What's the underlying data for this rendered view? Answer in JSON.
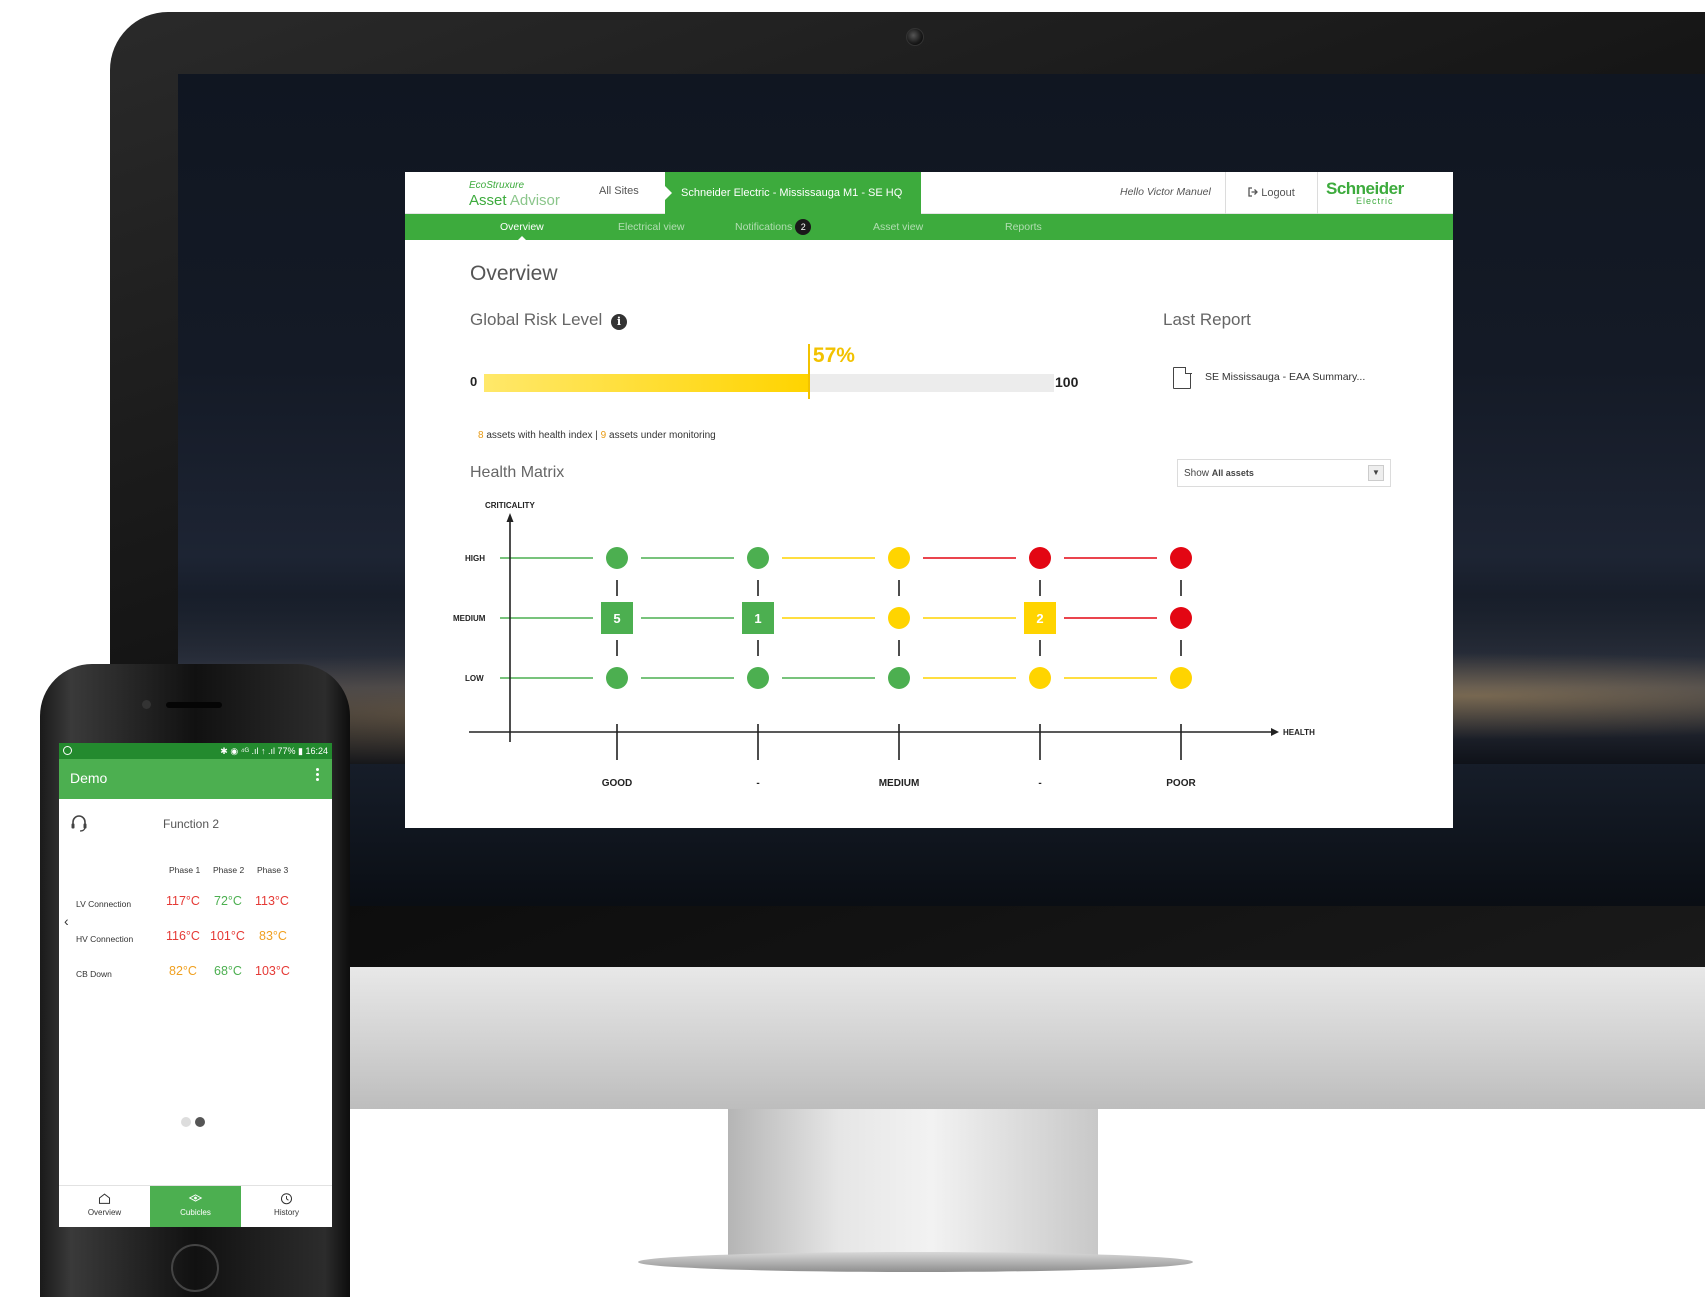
{
  "desktop": {
    "brand": {
      "line1": "EcoStruxure",
      "line2_a": "Asset ",
      "line2_b": "Advisor"
    },
    "header": {
      "all_sites": "All Sites",
      "site": "Schneider Electric - Mississauga M1 - SE HQ",
      "hello": "Hello Victor Manuel",
      "logout_icon": "logout-icon",
      "logout": "Logout",
      "logo_line1": "Schneider",
      "logo_line2": "Electric"
    },
    "nav": {
      "tabs": [
        {
          "label": "Overview",
          "active": true
        },
        {
          "label": "Electrical view",
          "active": false
        },
        {
          "label": "Notifications",
          "badge": "2",
          "active": false
        },
        {
          "label": "Asset view",
          "active": false
        },
        {
          "label": "Reports",
          "active": false
        }
      ]
    },
    "overview": {
      "title": "Overview",
      "risk_title": "Global Risk Level",
      "info_icon": "i",
      "gauge": {
        "min": "0",
        "max": "100",
        "value": 57,
        "value_label": "57%",
        "color": "#ffd400"
      },
      "assets": {
        "health_count": "8",
        "health_text": " assets with health index | ",
        "monitor_count": "9",
        "monitor_text": " assets under monitoring"
      },
      "last_report": {
        "title": "Last Report",
        "icon": "document-icon",
        "item": "SE Mississauga - EAA Summary..."
      },
      "health_matrix": {
        "title": "Health Matrix",
        "show_label": "Show",
        "show_value": "All assets",
        "y_axis": "CRITICALITY",
        "x_axis": "HEALTH",
        "rows": [
          "HIGH",
          "MEDIUM",
          "LOW"
        ],
        "columns": [
          "GOOD",
          "-",
          "MEDIUM",
          "-",
          "POOR"
        ],
        "cells": [
          [
            "green",
            "green",
            "yellow",
            "red",
            "red"
          ],
          [
            "green",
            "green",
            "yellow",
            "yellow",
            "red"
          ],
          [
            "green",
            "green",
            "green",
            "yellow",
            "yellow"
          ]
        ],
        "counts": [
          [
            null,
            null,
            null,
            null,
            null
          ],
          [
            "5",
            "1",
            null,
            "2",
            null
          ],
          [
            null,
            null,
            null,
            null,
            null
          ]
        ],
        "colors": {
          "green": "#4caf50",
          "yellow": "#ffd400",
          "red": "#e30613",
          "axis": "#222222"
        }
      }
    }
  },
  "mobile": {
    "status": "✱ ◉ ⁴ᴳ .ıl ↑ .ıl 77% ▮ 16:24",
    "title": "Demo",
    "function": "Function 2",
    "phases": [
      "Phase 1",
      "Phase 2",
      "Phase 3"
    ],
    "rows": [
      {
        "label": "LV Connection",
        "values": [
          "117°C",
          "72°C",
          "113°C"
        ],
        "colors": [
          "#e53935",
          "#4caf50",
          "#e53935"
        ]
      },
      {
        "label": "HV Connection",
        "values": [
          "116°C",
          "101°C",
          "83°C"
        ],
        "colors": [
          "#e53935",
          "#e53935",
          "#f0a020"
        ]
      },
      {
        "label": "CB Down",
        "values": [
          "82°C",
          "68°C",
          "103°C"
        ],
        "colors": [
          "#f0a020",
          "#4caf50",
          "#e53935"
        ]
      }
    ],
    "back": "‹",
    "tabs": [
      {
        "label": "Overview",
        "icon": "home-icon",
        "active": false
      },
      {
        "label": "Cubicles",
        "icon": "cubicles-icon",
        "active": true
      },
      {
        "label": "History",
        "icon": "history-icon",
        "active": false
      }
    ]
  }
}
